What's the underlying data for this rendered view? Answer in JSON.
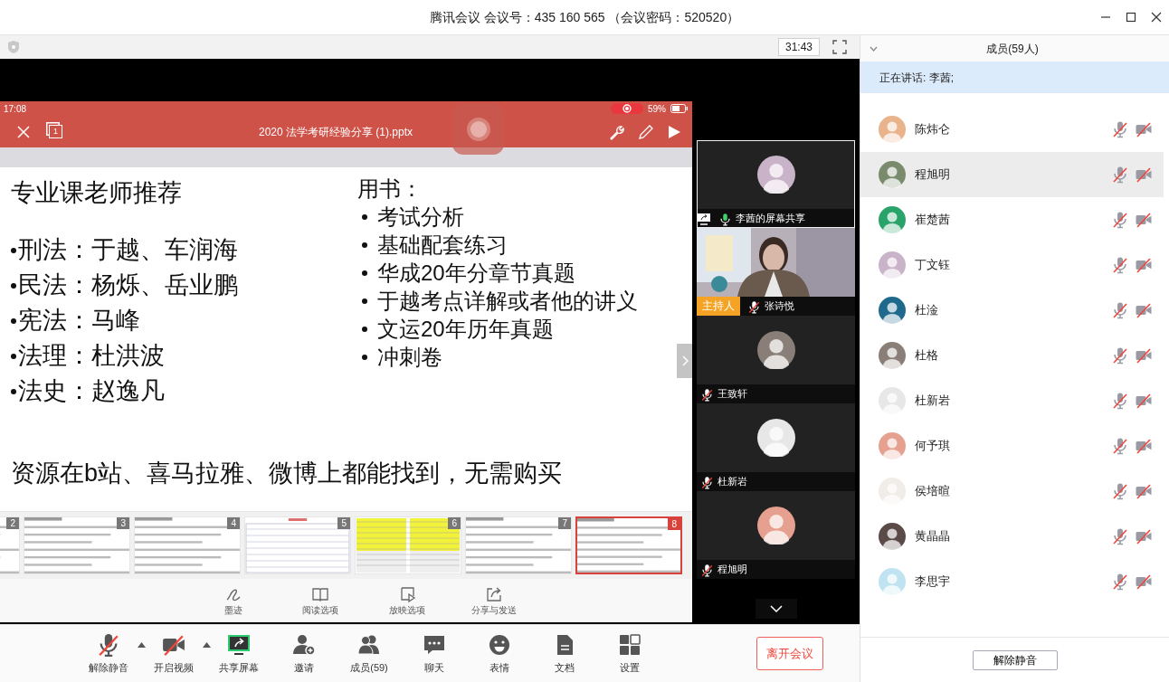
{
  "window": {
    "title": "腾讯会议 会议号：435 160 565 （会议密码：520520）"
  },
  "timer": "31:43",
  "shared_screen": {
    "status_bar": {
      "time": "17:08",
      "recording": true,
      "battery": "59%"
    },
    "page_indicator": "1",
    "document_title": "2020 法学考研经验分享 (1).pptx",
    "slide": {
      "heading": "专业课老师推荐",
      "teachers": [
        "刑法：于越、车润海",
        "民法：杨烁、岳业鹏",
        "宪法：马峰",
        "法理：杜洪波",
        "法史：赵逸凡"
      ],
      "books_heading": "用书：",
      "books": [
        "考试分析",
        "基础配套练习",
        "华成20年分章节真题",
        "于越考点详解或者他的讲义",
        "文运20年历年真题",
        "冲刺卷"
      ],
      "footer": "资源在b站、喜马拉雅、微博上都能找到，无需购买"
    },
    "thumbnails": [
      {
        "number": "2",
        "kind": "text",
        "selected": false
      },
      {
        "number": "3",
        "kind": "text",
        "selected": false
      },
      {
        "number": "4",
        "kind": "text",
        "selected": false
      },
      {
        "number": "5",
        "kind": "sheet",
        "selected": false
      },
      {
        "number": "6",
        "kind": "spreadsheet",
        "selected": false
      },
      {
        "number": "7",
        "kind": "text",
        "selected": false
      },
      {
        "number": "8",
        "kind": "text",
        "selected": true
      }
    ],
    "tools": [
      {
        "kind": "ink",
        "label": "墨迹"
      },
      {
        "kind": "read",
        "label": "阅读选项"
      },
      {
        "kind": "show",
        "label": "放映选项"
      },
      {
        "kind": "share",
        "label": "分享与发送"
      }
    ]
  },
  "video_tiles": [
    {
      "name": "李茜的屏幕共享",
      "kind": "avatar",
      "sharing": true,
      "muted": false,
      "focused": true
    },
    {
      "name": "张诗悦",
      "kind": "video",
      "sharing": false,
      "muted": true,
      "focused": false,
      "badge": "主持人"
    },
    {
      "name": "王致轩",
      "kind": "avatar",
      "sharing": false,
      "muted": true,
      "focused": false
    },
    {
      "name": "杜新岩",
      "kind": "avatar",
      "sharing": false,
      "muted": true,
      "focused": false
    },
    {
      "name": "程旭明",
      "kind": "avatar",
      "sharing": false,
      "muted": true,
      "focused": false
    }
  ],
  "toolbar": [
    {
      "kind": "mic",
      "label": "解除静音",
      "off": true,
      "menu": true
    },
    {
      "kind": "camera",
      "label": "开启视频",
      "off": true,
      "menu": true
    },
    {
      "kind": "share",
      "label": "共享屏幕",
      "off": false,
      "menu": false
    },
    {
      "kind": "invite",
      "label": "邀请",
      "off": false,
      "menu": false
    },
    {
      "kind": "members",
      "label": "成员(59)",
      "off": false,
      "menu": false
    },
    {
      "kind": "chat",
      "label": "聊天",
      "off": false,
      "menu": false
    },
    {
      "kind": "emoji",
      "label": "表情",
      "off": false,
      "menu": false
    },
    {
      "kind": "docs",
      "label": "文档",
      "off": false,
      "menu": false
    },
    {
      "kind": "settings",
      "label": "设置",
      "off": false,
      "menu": false
    }
  ],
  "leave_button": "离开会议",
  "members_panel": {
    "title": "成员(59人)",
    "speaking": "正在讲话: 李茜;",
    "members": [
      {
        "name": "陈炜仑",
        "highlighted": false,
        "muted": true,
        "video_off": true
      },
      {
        "name": "程旭明",
        "highlighted": true,
        "muted": true,
        "video_off": true
      },
      {
        "name": "崔楚茜",
        "highlighted": false,
        "muted": true,
        "video_off": true
      },
      {
        "name": "丁文钰",
        "highlighted": false,
        "muted": true,
        "video_off": true
      },
      {
        "name": "杜淦",
        "highlighted": false,
        "muted": true,
        "video_off": true
      },
      {
        "name": "杜格",
        "highlighted": false,
        "muted": true,
        "video_off": true
      },
      {
        "name": "杜新岩",
        "highlighted": false,
        "muted": true,
        "video_off": true
      },
      {
        "name": "何予琪",
        "highlighted": false,
        "muted": true,
        "video_off": true
      },
      {
        "name": "侯培暄",
        "highlighted": false,
        "muted": true,
        "video_off": true
      },
      {
        "name": "黄晶晶",
        "highlighted": false,
        "muted": true,
        "video_off": true
      },
      {
        "name": "李思宇",
        "highlighted": false,
        "muted": true,
        "video_off": true
      }
    ],
    "unmute_all_button": "解除静音"
  }
}
